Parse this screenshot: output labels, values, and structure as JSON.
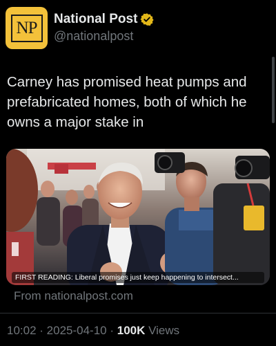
{
  "account": {
    "display_name": "National Post",
    "handle": "@nationalpost",
    "logo_text": "NP",
    "verified": true,
    "verified_color": "#e2b719",
    "avatar_color": "#f3c13a"
  },
  "tweet": {
    "text": "Carney has promised heat pumps and prefabricated homes, both of which he owns a major stake in"
  },
  "media": {
    "caption": "FIRST READING: Liberal promises just keep happening to intersect..."
  },
  "link_source": "From nationalpost.com",
  "meta": {
    "time": "10:02",
    "separator": " · ",
    "date": "2025-04-10",
    "views_count": "100K",
    "views_label": " Views"
  },
  "icons": {
    "verified": "verified-badge-icon"
  }
}
